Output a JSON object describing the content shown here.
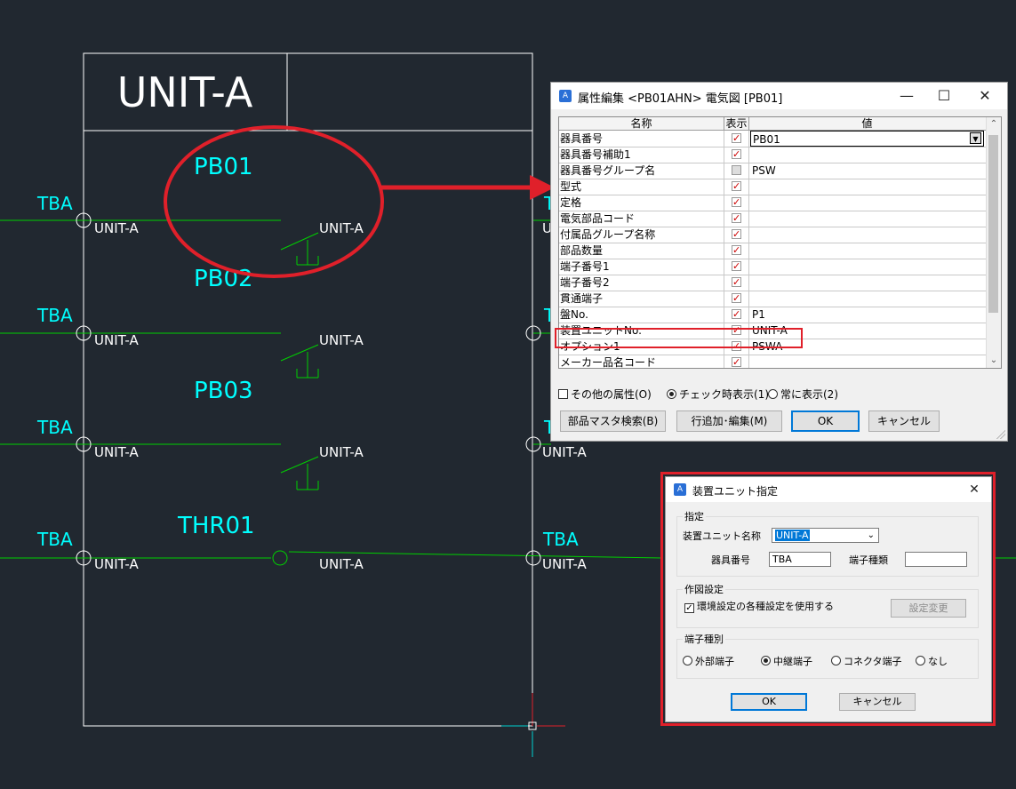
{
  "cad": {
    "unit_title": "UNIT-A",
    "device_labels": [
      "PB01",
      "PB02",
      "PB03",
      "THR01"
    ],
    "terminal_labels": [
      "TBA",
      "TBA",
      "TBA",
      "TBA"
    ],
    "right_terminal_label": "TBA",
    "unit_text": "UNIT-A",
    "partial_char": "T",
    "partial_unit_char": "U",
    "colors": {
      "background": "#212830",
      "wire": "#00d000",
      "cyan": "#00ffff",
      "white": "#ffffff",
      "highlight": "#e0202a"
    }
  },
  "attr_dialog": {
    "title": "属性編集 <PB01AHN> 電気図 [PB01]",
    "columns": {
      "name": "名称",
      "show": "表示",
      "value": "値"
    },
    "rows": [
      {
        "name": "器具番号",
        "checked": true,
        "value": "PB01"
      },
      {
        "name": "器具番号補助1",
        "checked": true,
        "value": ""
      },
      {
        "name": "器具番号グループ名",
        "checked": false,
        "value": "PSW"
      },
      {
        "name": "型式",
        "checked": true,
        "value": ""
      },
      {
        "name": "定格",
        "checked": true,
        "value": ""
      },
      {
        "name": "電気部品コード",
        "checked": true,
        "value": ""
      },
      {
        "name": "付属品グループ名称",
        "checked": true,
        "value": ""
      },
      {
        "name": "部品数量",
        "checked": true,
        "value": ""
      },
      {
        "name": "端子番号1",
        "checked": true,
        "value": ""
      },
      {
        "name": "端子番号2",
        "checked": true,
        "value": ""
      },
      {
        "name": "貫通端子",
        "checked": true,
        "value": ""
      },
      {
        "name": "盤No.",
        "checked": true,
        "value": "P1"
      },
      {
        "name": "装置ユニットNo.",
        "checked": true,
        "value": "UNIT-A"
      },
      {
        "name": "オプション1",
        "checked": true,
        "value": "PSWA"
      },
      {
        "name": "メーカー品名コード",
        "checked": true,
        "value": ""
      }
    ],
    "option_other": "その他の属性(O)",
    "radio_checked_show": "チェック時表示(1)",
    "radio_always_show": "常に表示(2)",
    "btn_master": "部品マスタ検索(B)",
    "btn_row_edit": "行追加･編集(M)",
    "btn_ok": "OK",
    "btn_cancel": "キャンセル"
  },
  "unit_dialog": {
    "title": "装置ユニット指定",
    "group_spec": "指定",
    "unit_name_label": "装置ユニット名称",
    "unit_name_value": "UNIT-A",
    "device_no_label": "器具番号",
    "device_no_value": "TBA",
    "terminal_type_label": "端子種類",
    "terminal_type_value": "",
    "group_draw": "作図設定",
    "use_env_label": "環境設定の各種設定を使用する",
    "btn_change": "設定変更",
    "group_kind": "端子種別",
    "radio_external": "外部端子",
    "radio_relay": "中継端子",
    "radio_connector": "コネクタ端子",
    "radio_none": "なし",
    "btn_ok": "OK",
    "btn_cancel": "キャンセル"
  }
}
